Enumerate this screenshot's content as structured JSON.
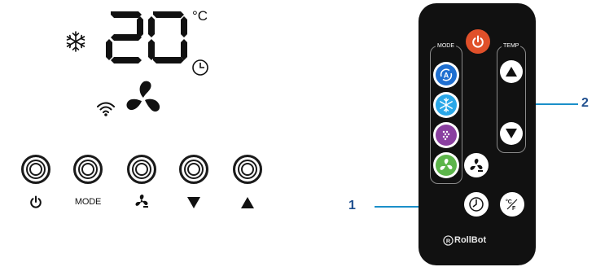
{
  "display": {
    "temperature": "20",
    "unit": "°C"
  },
  "buttons": [
    {
      "id": "power",
      "label": "",
      "icon": "power-icon"
    },
    {
      "id": "mode",
      "label": "MODE",
      "icon": ""
    },
    {
      "id": "fan",
      "label": "",
      "icon": "fan-icon"
    },
    {
      "id": "down",
      "label": "",
      "icon": "down-triangle-icon"
    },
    {
      "id": "up",
      "label": "",
      "icon": "up-triangle-icon"
    }
  ],
  "remote": {
    "mode_label": "MODE",
    "temp_label": "TEMP",
    "brand": "RollBot",
    "unit_toggle_label": "°C/°F",
    "colors": {
      "body": "#111111",
      "power": "#e0502a",
      "auto": "#1f6fd0",
      "cool": "#2aa7e8",
      "dry": "#8a3fa0",
      "fan": "#5cb54a"
    }
  },
  "callouts": [
    {
      "number": "1",
      "color": "#1f4f8f"
    },
    {
      "number": "2",
      "color": "#1f4f8f"
    }
  ]
}
